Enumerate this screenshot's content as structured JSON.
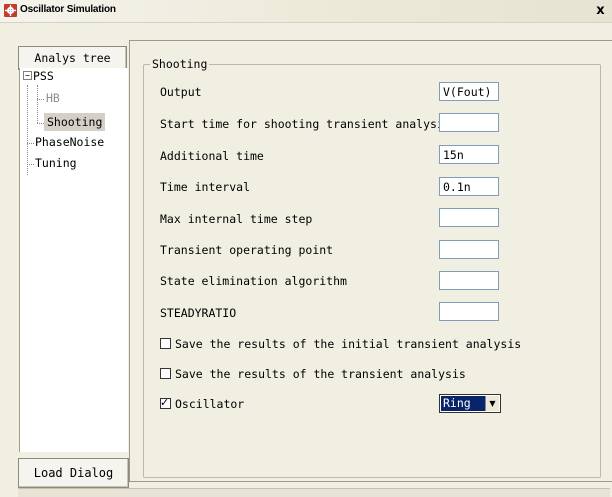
{
  "window": {
    "title": "Oscillator Simulation",
    "close_label": "x",
    "icon": "app-gear-icon"
  },
  "tree": {
    "header_label": "Analys tree",
    "items": [
      {
        "label": "PSS",
        "level": 0,
        "expanded": true
      },
      {
        "label": "HB",
        "level": 1,
        "disabled": true
      },
      {
        "label": "Shooting",
        "level": 1,
        "selected": true
      },
      {
        "label": "PhaseNoise",
        "level": 0
      },
      {
        "label": "Tuning",
        "level": 0
      }
    ],
    "expander_symbol": "−"
  },
  "load_button": {
    "label": "Load Dialog"
  },
  "shooting": {
    "group_title": "Shooting",
    "fields": [
      {
        "label": "Output",
        "value": "V(Fout)"
      },
      {
        "label": "Start time for shooting transient analysis",
        "value": ""
      },
      {
        "label": "Additional time",
        "value": "15n"
      },
      {
        "label": "Time interval",
        "value": "0.1n"
      },
      {
        "label": "Max internal time step",
        "value": ""
      },
      {
        "label": "Transient operating point",
        "value": ""
      },
      {
        "label": "State elimination algorithm",
        "value": ""
      },
      {
        "label": "STEADYRATIO",
        "value": ""
      }
    ],
    "checkboxes": [
      {
        "label": "Save the results of the initial transient analysis",
        "checked": false
      },
      {
        "label": "Save the results of the transient analysis",
        "checked": false
      },
      {
        "label": "Oscillator",
        "checked": true
      }
    ],
    "oscillator_type": {
      "selected": "Ring",
      "arrow": "▼"
    }
  },
  "colors": {
    "background": "#f1efe2",
    "selection": "#0a246a",
    "tree_selected": "#d4d0c8",
    "field_border": "#7f9db9"
  }
}
